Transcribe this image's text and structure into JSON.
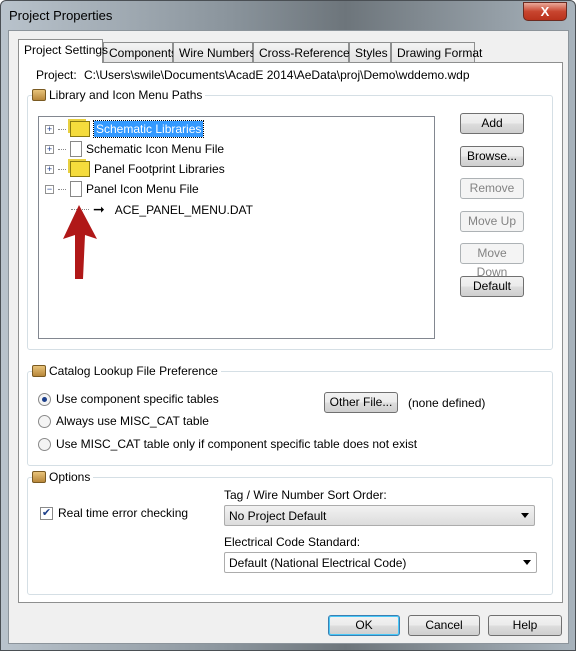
{
  "window": {
    "title": "Project Properties",
    "close": "X"
  },
  "tabs": [
    "Project Settings",
    "Components",
    "Wire Numbers",
    "Cross-References",
    "Styles",
    "Drawing Format"
  ],
  "project": {
    "label": "Project:",
    "path": "C:\\Users\\swile\\Documents\\AcadE 2014\\AeData\\proj\\Demo\\wddemo.wdp"
  },
  "library": {
    "title": "Library and Icon Menu Paths",
    "tree": [
      {
        "label": "Schematic Libraries",
        "icon": "folders-icon",
        "expanded": false,
        "selected": true
      },
      {
        "label": "Schematic Icon Menu File",
        "icon": "file-icon",
        "expanded": false
      },
      {
        "label": "Panel Footprint Libraries",
        "icon": "folders-icon",
        "expanded": false
      },
      {
        "label": "Panel Icon Menu File",
        "icon": "file-icon",
        "expanded": true,
        "children": [
          {
            "label": "ACE_PANEL_MENU.DAT",
            "icon": "arrow-icon"
          }
        ]
      }
    ],
    "buttons": {
      "add": "Add",
      "browse": "Browse...",
      "remove": "Remove",
      "move_up": "Move Up",
      "move_down": "Move Down",
      "default": "Default"
    }
  },
  "catalog": {
    "title": "Catalog Lookup File Preference",
    "options": [
      "Use component specific tables",
      "Always use MISC_CAT table",
      "Use MISC_CAT table only if component specific table does not exist"
    ],
    "selected": 0,
    "other_file": "Other File...",
    "none_defined": "(none defined)"
  },
  "options": {
    "title": "Options",
    "realtime": "Real time error checking",
    "realtime_checked": true,
    "sort_label": "Tag / Wire Number Sort Order:",
    "sort_value": "No Project Default",
    "standard_label": "Electrical Code Standard:",
    "standard_value": "Default (National Electrical Code)"
  },
  "footer": {
    "ok": "OK",
    "cancel": "Cancel",
    "help": "Help"
  },
  "annotation_color": "#b01818"
}
